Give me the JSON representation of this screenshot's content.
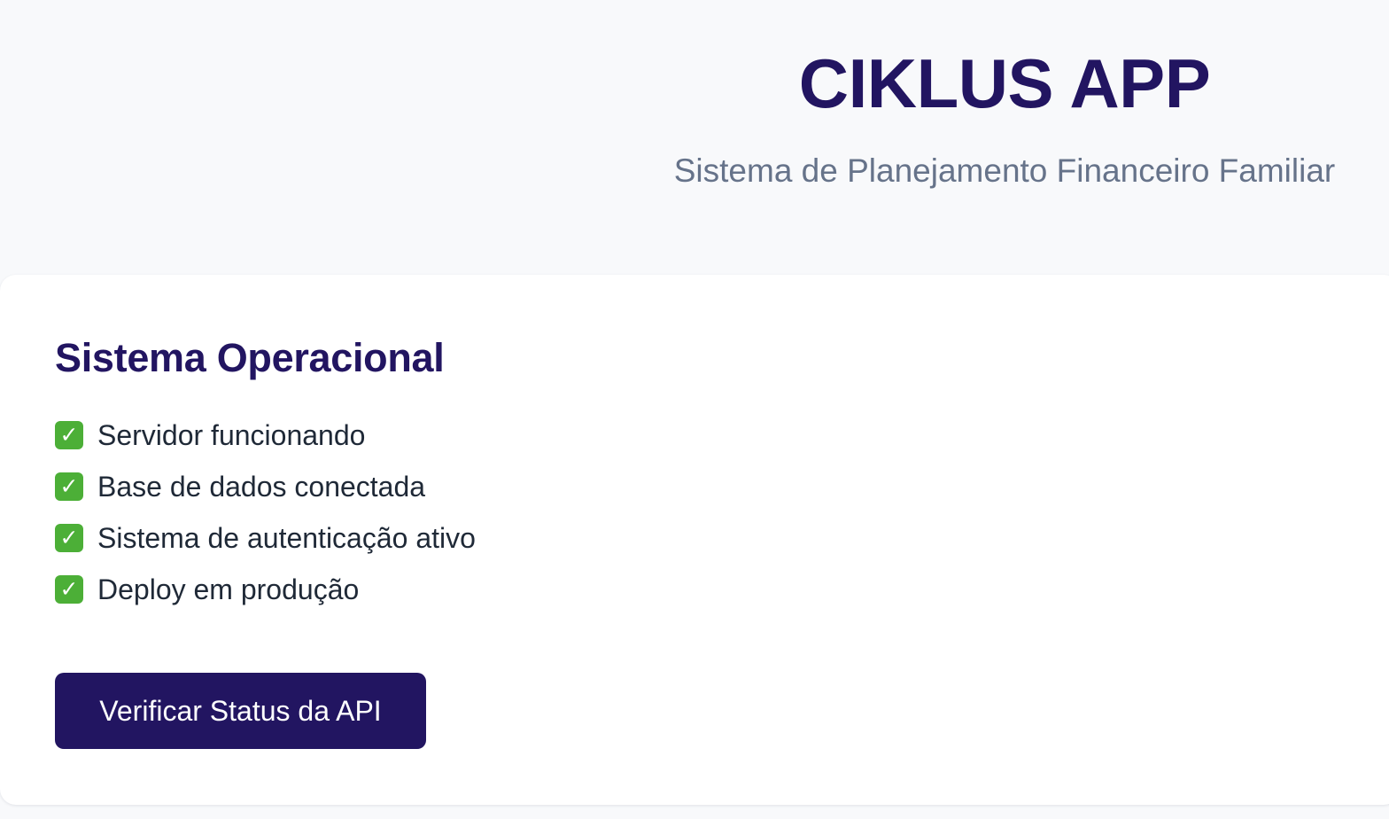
{
  "app": {
    "title": "CIKLUS APP",
    "subtitle": "Sistema de Planejamento Financeiro Familiar"
  },
  "status_card": {
    "title": "Sistema Operacional",
    "items": [
      {
        "icon": "check-mark-icon",
        "label": "Servidor funcionando"
      },
      {
        "icon": "check-mark-icon",
        "label": "Base de dados conectada"
      },
      {
        "icon": "check-mark-icon",
        "label": "Sistema de autenticação ativo"
      },
      {
        "icon": "check-mark-icon",
        "label": "Deploy em produção"
      }
    ],
    "button_label": "Verificar Status da API"
  },
  "colors": {
    "page_background": "#f8f9fb",
    "brand_navy": "#221561",
    "subtitle_gray": "#66738a",
    "card_background": "#ffffff",
    "check_green": "#4caf37",
    "body_text": "#1f2937"
  }
}
